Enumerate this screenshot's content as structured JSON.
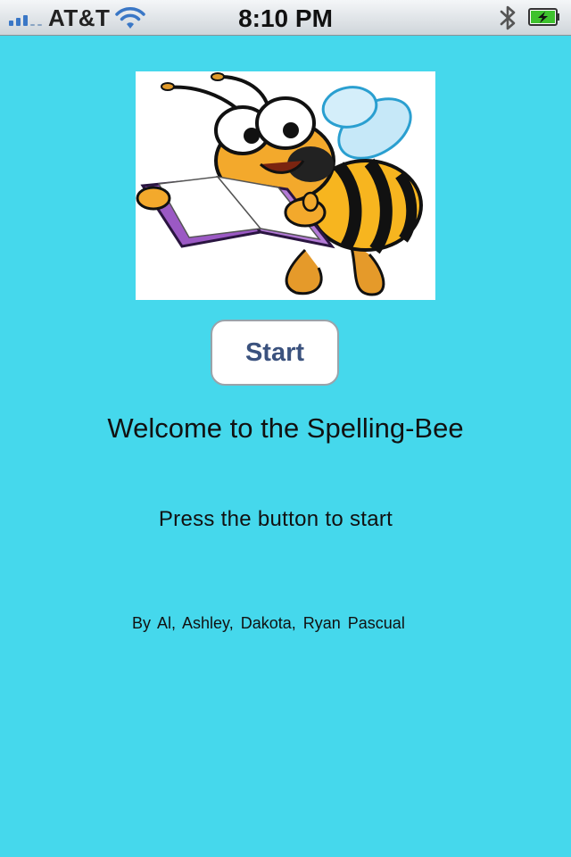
{
  "status_bar": {
    "carrier": "AT&T",
    "time": "8:10 PM",
    "signal_bars": 3,
    "battery_charging": true,
    "colors": {
      "signal": "#3a77c6",
      "battery_fill": "#3ec22e"
    },
    "icons": [
      "signal-icon",
      "wifi-icon",
      "bluetooth-icon",
      "battery-icon"
    ]
  },
  "main": {
    "image_alt": "Cartoon bee reading a purple book",
    "start_button_label": "Start",
    "welcome_text": "Welcome to the Spelling-Bee",
    "instruction_text": "Press the button to start",
    "credits": "By Al, Ashley, Dakota, Ryan Pascual"
  },
  "colors": {
    "background": "#45d8ec",
    "button_text": "#3b527e"
  }
}
